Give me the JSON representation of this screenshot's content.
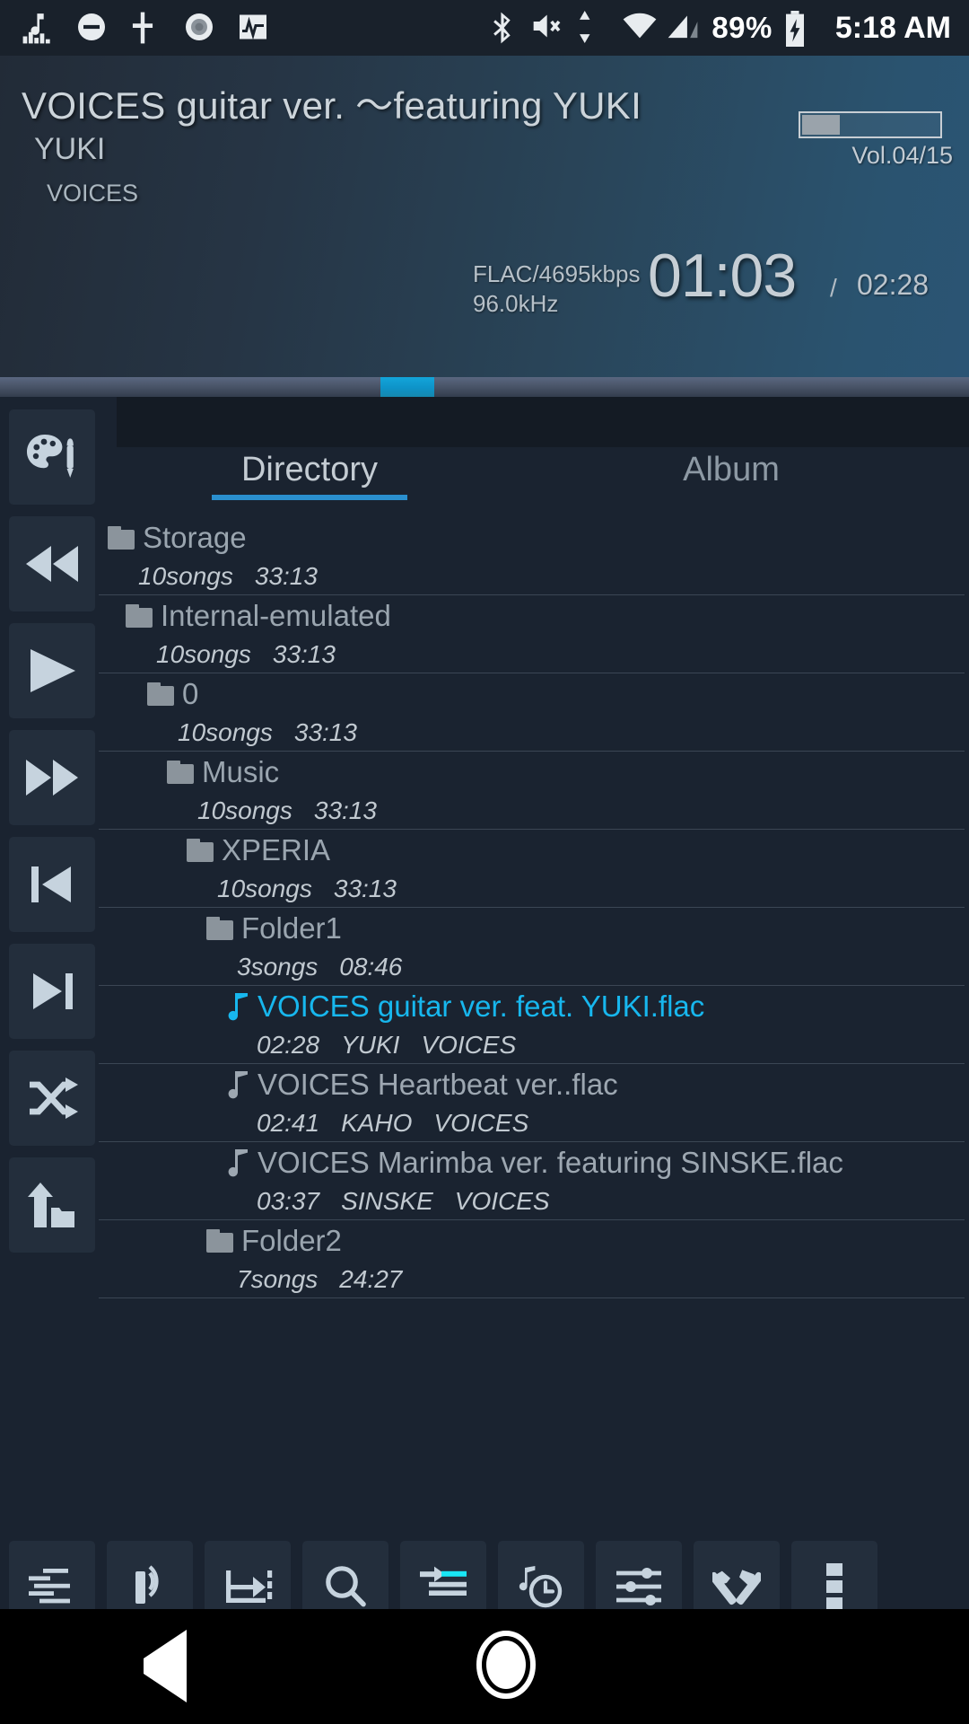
{
  "statusbar": {
    "left_icons": [
      "music-equalizer-icon",
      "do-not-disturb-icon",
      "vertical-slider-icon",
      "record-circle-icon",
      "waveform-icon"
    ],
    "right_icons": [
      "bluetooth-icon",
      "volume-mute-icon",
      "data-transfer-icon",
      "wifi-icon",
      "cellular-signal-icon"
    ],
    "battery_percent": "89%",
    "battery_icon": "battery-charging-icon",
    "clock": "5:18 AM"
  },
  "now_playing": {
    "title": "VOICES guitar ver. 〜featuring YUKI",
    "artist": "YUKI",
    "album": "VOICES",
    "codec_line1": "FLAC/4695kbps",
    "codec_line2": "96.0kHz",
    "elapsed": "01:03",
    "separator": "/",
    "total": "02:28",
    "volume_label": "Vol.04/15",
    "volume_level": 4,
    "volume_max": 15,
    "progress_percent": 42,
    "accent_color": "#0e93c8"
  },
  "rail": [
    {
      "name": "theme-palette-button",
      "icon": "palette-icon"
    },
    {
      "name": "rewind-button",
      "icon": "rewind-icon"
    },
    {
      "name": "play-button",
      "icon": "play-icon"
    },
    {
      "name": "fast-forward-button",
      "icon": "fast-forward-icon"
    },
    {
      "name": "previous-track-button",
      "icon": "skip-previous-icon"
    },
    {
      "name": "next-track-button",
      "icon": "skip-next-icon"
    },
    {
      "name": "shuffle-button",
      "icon": "shuffle-icon"
    },
    {
      "name": "parent-folder-button",
      "icon": "up-folder-icon"
    }
  ],
  "tabs": [
    {
      "label": "Directory",
      "active": true
    },
    {
      "label": "Album",
      "active": false
    }
  ],
  "list": [
    {
      "type": "folder",
      "name": "Storage",
      "indent": 0,
      "songs": "10songs",
      "duration": "33:13",
      "playing": false
    },
    {
      "type": "folder",
      "name": "Internal-emulated",
      "indent": 1,
      "songs": "10songs",
      "duration": "33:13",
      "playing": false
    },
    {
      "type": "folder",
      "name": "0",
      "indent": 2,
      "songs": "10songs",
      "duration": "33:13",
      "playing": false
    },
    {
      "type": "folder",
      "name": "Music",
      "indent": 3,
      "songs": "10songs",
      "duration": "33:13",
      "playing": false
    },
    {
      "type": "folder",
      "name": "XPERIA",
      "indent": 4,
      "songs": "10songs",
      "duration": "33:13",
      "playing": false
    },
    {
      "type": "folder",
      "name": "Folder1",
      "indent": 5,
      "songs": "3songs",
      "duration": "08:46",
      "playing": false
    },
    {
      "type": "track",
      "name": "VOICES guitar ver. feat. YUKI.flac",
      "indent": 6,
      "duration": "02:28",
      "artist": "YUKI",
      "album": "VOICES",
      "playing": true
    },
    {
      "type": "track",
      "name": "VOICES Heartbeat ver..flac",
      "indent": 6,
      "duration": "02:41",
      "artist": "KAHO",
      "album": "VOICES",
      "playing": false
    },
    {
      "type": "track",
      "name": "VOICES Marimba ver. featuring SINSKE.flac",
      "indent": 6,
      "duration": "03:37",
      "artist": "SINSKE",
      "album": "VOICES",
      "playing": false
    },
    {
      "type": "folder",
      "name": "Folder2",
      "indent": 5,
      "songs": "7songs",
      "duration": "24:27",
      "playing": false
    }
  ],
  "toolbar": [
    {
      "name": "equalizer-button",
      "icon": "equalizer-icon",
      "active": true
    },
    {
      "name": "cast-button",
      "icon": "wireless-cast-icon",
      "active": false
    },
    {
      "name": "ab-repeat-button",
      "icon": "ab-repeat-icon",
      "active": false
    },
    {
      "name": "search-button",
      "icon": "search-icon",
      "active": false
    },
    {
      "name": "jump-to-playing-button",
      "icon": "jump-to-list-icon",
      "active": true
    },
    {
      "name": "sleep-timer-button",
      "icon": "note-clock-icon",
      "active": false
    },
    {
      "name": "settings-button",
      "icon": "sliders-icon",
      "active": false
    },
    {
      "name": "tools-button",
      "icon": "hammer-wrench-icon",
      "active": false
    },
    {
      "name": "overflow-menu-button",
      "icon": "more-vertical-icon",
      "active": false
    }
  ],
  "navbar": [
    {
      "name": "android-back-button",
      "icon": "triangle-back-icon"
    },
    {
      "name": "android-home-button",
      "icon": "circle-home-icon"
    },
    {
      "name": "android-recents-button",
      "icon": "square-recents-icon"
    }
  ]
}
